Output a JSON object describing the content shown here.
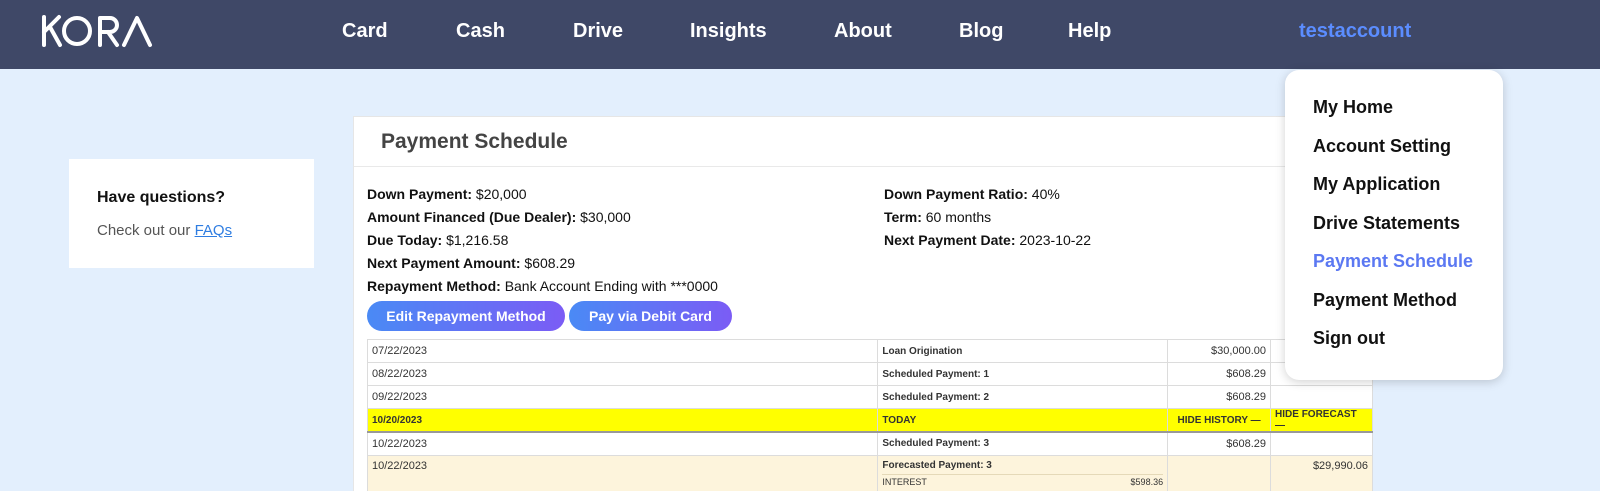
{
  "brand": {
    "logo_text": "KORA"
  },
  "nav": {
    "items": [
      {
        "label": "Card"
      },
      {
        "label": "Cash"
      },
      {
        "label": "Drive"
      },
      {
        "label": "Insights"
      },
      {
        "label": "About"
      },
      {
        "label": "Blog"
      },
      {
        "label": "Help"
      }
    ],
    "account": "testaccount"
  },
  "sidebar": {
    "question": "Have questions?",
    "check_out": "Check out our ",
    "faq_link": "FAQs"
  },
  "main": {
    "title": "Payment Schedule",
    "fields": {
      "down_payment": {
        "label": "Down Payment:",
        "value": "$20,000"
      },
      "amount_financed": {
        "label": "Amount Financed (Due Dealer):",
        "value": "$30,000"
      },
      "due_today": {
        "label": "Due Today:",
        "value": "$1,216.58"
      },
      "next_payment_amount": {
        "label": "Next Payment Amount:",
        "value": "$608.29"
      },
      "repayment_method": {
        "label": "Repayment Method:",
        "value": "Bank Account Ending with ***0000"
      },
      "down_payment_ratio": {
        "label": "Down Payment Ratio:",
        "value": "40%"
      },
      "term": {
        "label": "Term:",
        "value": "60 months"
      },
      "next_payment_date": {
        "label": "Next Payment Date:",
        "value": "2023-10-22"
      }
    },
    "buttons": {
      "edit_repayment": "Edit Repayment Method",
      "pay_debit": "Pay via Debit Card"
    },
    "schedule": {
      "rows": [
        {
          "date": "07/22/2023",
          "label": "Loan Origination",
          "amount": "$30,000.00",
          "balance": ""
        },
        {
          "date": "08/22/2023",
          "label": "Scheduled Payment: 1",
          "amount": "$608.29",
          "balance": ""
        },
        {
          "date": "09/22/2023",
          "label": "Scheduled Payment: 2",
          "amount": "$608.29",
          "balance": ""
        }
      ],
      "today": {
        "date": "10/20/2023",
        "label": "TODAY",
        "hide_history": "HIDE HISTORY",
        "hide_forecast": "HIDE FORECAST"
      },
      "after_rows": [
        {
          "date": "10/22/2023",
          "label": "Scheduled Payment: 3",
          "amount": "$608.29",
          "balance": ""
        }
      ],
      "forecast": {
        "date": "10/22/2023",
        "label": "Forecasted Payment: 3",
        "interest_label": "INTEREST",
        "interest_value": "$598.36",
        "balance": "$29,990.06"
      }
    }
  },
  "account_menu": {
    "items": [
      {
        "label": "My Home"
      },
      {
        "label": "Account Setting"
      },
      {
        "label": "My Application"
      },
      {
        "label": "Drive Statements"
      },
      {
        "label": "Payment Schedule",
        "active": true
      },
      {
        "label": "Payment Method"
      },
      {
        "label": "Sign out"
      }
    ]
  }
}
